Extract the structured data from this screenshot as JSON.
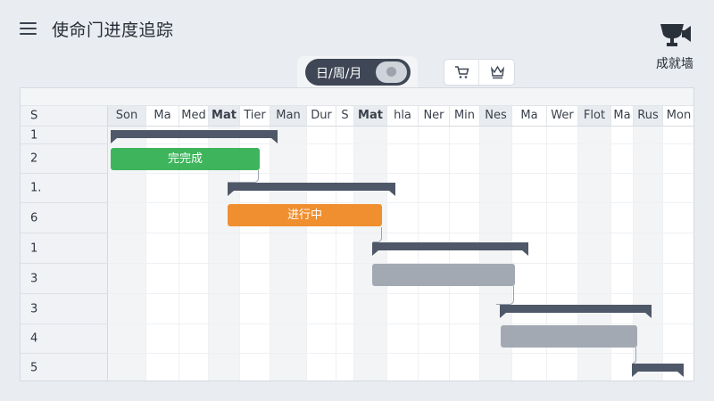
{
  "header": {
    "title": "使命门进度追踪"
  },
  "wall_button": {
    "label": "成就墙",
    "icon": "trophy-megaphone-icon"
  },
  "view_toggle": {
    "label": "日/周/月",
    "knob_icon": "lightbulb-icon"
  },
  "toolbar_icons": [
    {
      "icon": "cart-icon"
    },
    {
      "icon": "crown-icon"
    }
  ],
  "grid": {
    "first_column_header": "S",
    "days": [
      {
        "label": "Son",
        "shaded": true,
        "bold": false
      },
      {
        "label": "Ma",
        "shaded": false,
        "bold": false
      },
      {
        "label": "Med",
        "shaded": false,
        "bold": false
      },
      {
        "label": "Mat",
        "shaded": true,
        "bold": true
      },
      {
        "label": "Tier",
        "shaded": false,
        "bold": false
      },
      {
        "label": "Man",
        "shaded": true,
        "bold": false
      },
      {
        "label": "Dur",
        "shaded": false,
        "bold": false
      },
      {
        "label": "S",
        "shaded": false,
        "bold": false
      },
      {
        "label": "Mat",
        "shaded": true,
        "bold": true
      },
      {
        "label": "hla",
        "shaded": false,
        "bold": false
      },
      {
        "label": "Ner",
        "shaded": false,
        "bold": false
      },
      {
        "label": "Min",
        "shaded": false,
        "bold": false
      },
      {
        "label": "Nes",
        "shaded": true,
        "bold": false
      },
      {
        "label": "Ma",
        "shaded": false,
        "bold": false
      },
      {
        "label": "Wer",
        "shaded": false,
        "bold": false
      },
      {
        "label": "Flot",
        "shaded": true,
        "bold": false
      },
      {
        "label": "Ma",
        "shaded": false,
        "bold": false
      },
      {
        "label": "Rus",
        "shaded": true,
        "bold": false
      },
      {
        "label": "Mon",
        "shaded": false,
        "bold": false
      }
    ],
    "rows": [
      "1",
      "2",
      "1.",
      "6",
      "1",
      "3",
      "3",
      "4",
      "5"
    ]
  },
  "tasks": [
    {
      "type": "summary",
      "row": 0
    },
    {
      "type": "task",
      "row": 1,
      "status": "done",
      "label": "完完成"
    },
    {
      "type": "summary",
      "row": 2
    },
    {
      "type": "task",
      "row": 3,
      "status": "doing",
      "label": "进行中"
    },
    {
      "type": "summary",
      "row": 4
    },
    {
      "type": "task",
      "row": 5,
      "status": "todo",
      "label": ""
    },
    {
      "type": "summary",
      "row": 6
    },
    {
      "type": "task",
      "row": 7,
      "status": "todo",
      "label": ""
    },
    {
      "type": "summary",
      "row": 8
    }
  ],
  "colors": {
    "done": "#3eb55c",
    "doing": "#f08f2f",
    "todo": "#a3a9b3",
    "summary": "#4e5868",
    "toggle_bg": "#3f4756"
  }
}
